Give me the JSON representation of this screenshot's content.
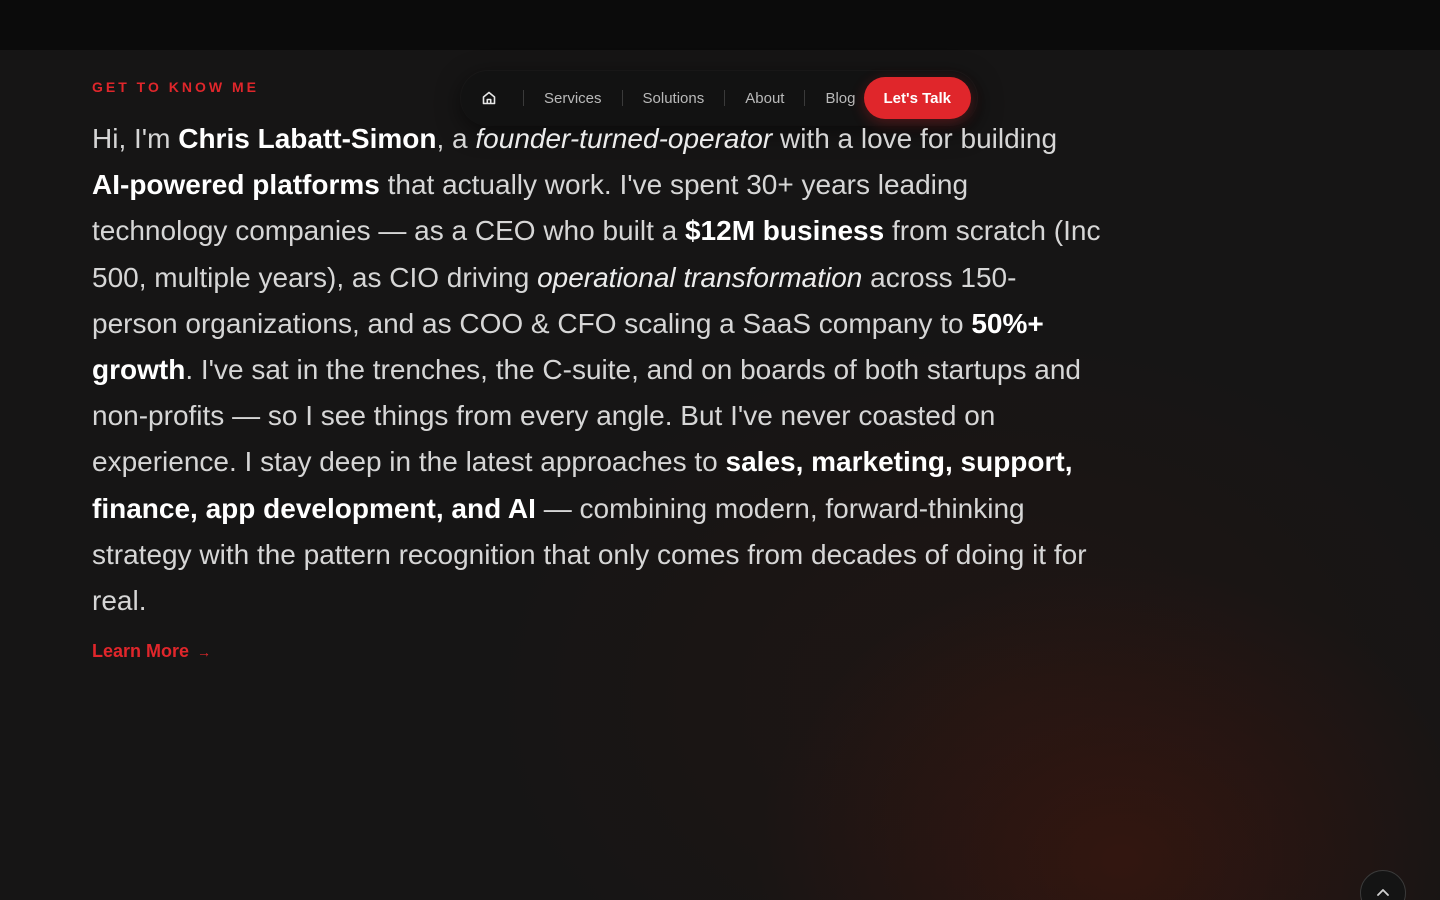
{
  "nav": {
    "home_icon": "home-icon",
    "items": [
      {
        "label": "Services"
      },
      {
        "label": "Solutions"
      },
      {
        "label": "About"
      },
      {
        "label": "Blog"
      }
    ],
    "cta_label": "Let's Talk"
  },
  "section": {
    "eyebrow": "GET TO KNOW ME",
    "bio": {
      "p1": "Hi, I'm ",
      "name": "Chris Labatt-Simon",
      "p2": ", a ",
      "role": "founder-turned-operator",
      "p3": " with a love for building ",
      "platforms": "AI-powered platforms",
      "p4": " that actually work. I've spent 30+ years leading technology companies — as a CEO who built a ",
      "business": "$12M business",
      "p5": " from scratch (Inc 500, multiple years), as CIO driving ",
      "transformation": "operational transformation",
      "p6": " across 150-person organizations, and as COO & CFO scaling a SaaS company to ",
      "growth": "50%+ growth",
      "p7": ". I've sat in the trenches, the C-suite, and on boards of both startups and non-profits — so I see things from every angle. But I've never coasted on experience. I stay deep in the latest approaches to ",
      "areas": "sales, marketing, support, finance, app development, and AI",
      "p8": " — combining modern, forward-thinking strategy with the pattern recognition that only comes from decades of doing it for real."
    },
    "learn_more": "Learn More",
    "learn_more_arrow": "→"
  },
  "scroll_top_icon": "chevron-up-icon",
  "colors": {
    "accent": "#e0262b",
    "background": "#161515",
    "text": "#d6d6d6"
  }
}
